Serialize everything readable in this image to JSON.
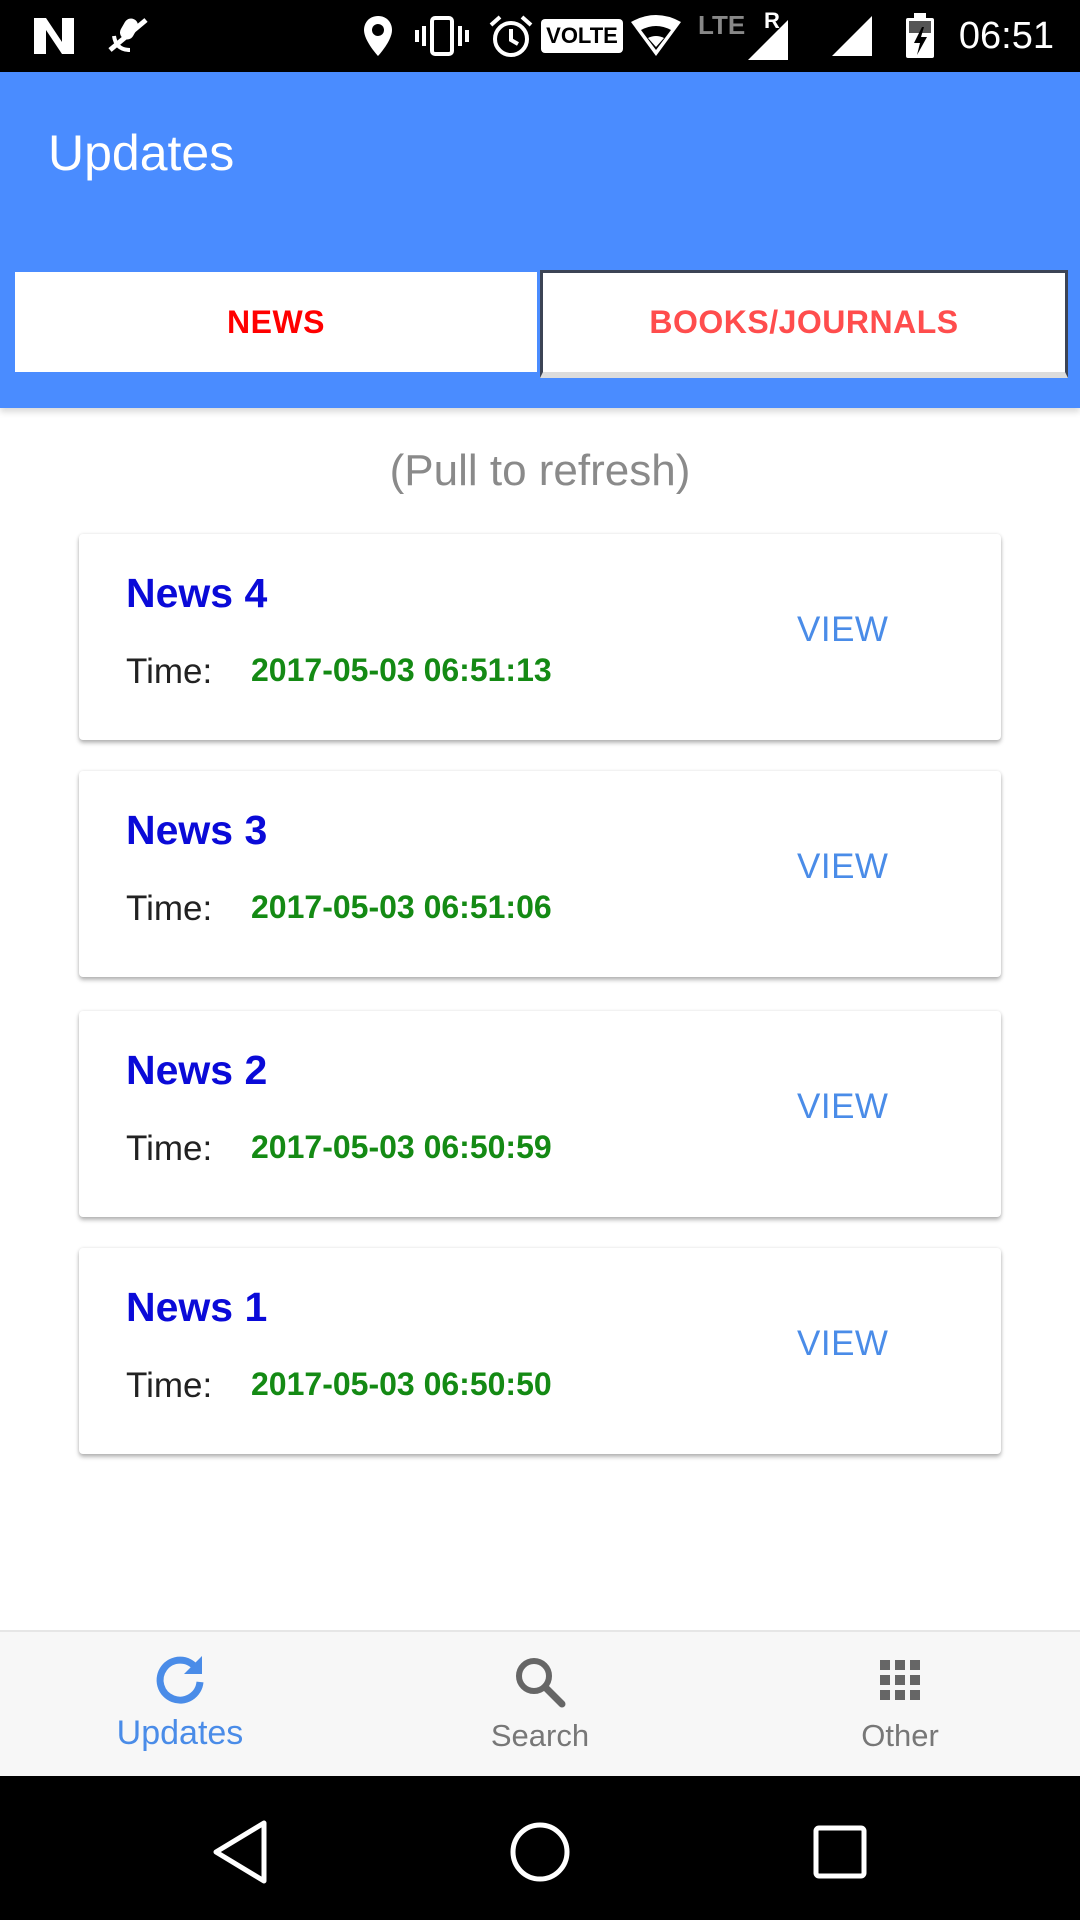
{
  "status_bar": {
    "time": "06:51",
    "icons": [
      "n-logo-icon",
      "no-mic-icon",
      "location-icon",
      "vibrate-icon",
      "alarm-icon",
      "volte-icon",
      "wifi-icon",
      "lte-roaming-signal-icon",
      "signal-icon",
      "battery-charging-icon"
    ],
    "volte_label": "VOLTE",
    "lte_label": "LTE",
    "roaming_label": "R"
  },
  "app_bar": {
    "title": "Updates",
    "color": "#4a8cff"
  },
  "tabs": [
    {
      "label": "NEWS",
      "selected": true
    },
    {
      "label": "BOOKS/JOURNALS",
      "selected": false
    }
  ],
  "content": {
    "pull_hint": "(Pull to refresh)",
    "time_label": "Time:",
    "view_label": "VIEW",
    "items": [
      {
        "title": "News 4",
        "time": "2017-05-03 06:51:13"
      },
      {
        "title": "News 3",
        "time": "2017-05-03 06:51:06"
      },
      {
        "title": "News 2",
        "time": "2017-05-03 06:50:59"
      },
      {
        "title": "News 1",
        "time": "2017-05-03 06:50:50"
      }
    ]
  },
  "bottom_nav": {
    "items": [
      {
        "label": "Updates",
        "icon": "refresh-icon",
        "active": true
      },
      {
        "label": "Search",
        "icon": "search-icon",
        "active": false
      },
      {
        "label": "Other",
        "icon": "grid-icon",
        "active": false
      }
    ],
    "active_color": "#4a8ce8"
  },
  "system_nav": {
    "icons": [
      "back-icon",
      "home-icon",
      "recents-icon"
    ]
  },
  "colors": {
    "title_blue": "#0a0ad8",
    "time_green": "#148a14",
    "tab_red": "#ff0000"
  }
}
